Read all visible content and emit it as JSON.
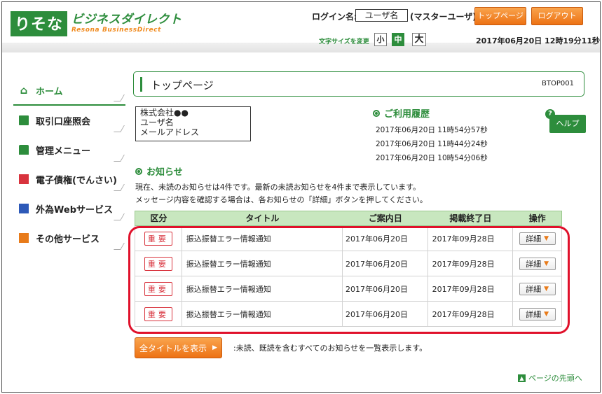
{
  "header": {
    "logo_mark": "りそな",
    "logo_jp": "ビジネスダイレクト",
    "logo_en": "Resona BusinessDirect",
    "login_label": "ログイン名:",
    "login_user": "ユーザ名",
    "login_role": "(マスターユーザ)",
    "top_page_label": "トップページへ",
    "logout_label": "ログアウト",
    "font_size_label": "文字サイズを変更",
    "font_small": "小",
    "font_mid": "中",
    "font_large": "大",
    "datetime": "2017年06月20日 12時19分11秒"
  },
  "sidebar": {
    "items": [
      {
        "label": "ホーム"
      },
      {
        "label": "取引口座照会"
      },
      {
        "label": "管理メニュー"
      },
      {
        "label": "電子債権(でんさい)"
      },
      {
        "label": "外為Webサービス"
      },
      {
        "label": "その他サービス"
      }
    ]
  },
  "main": {
    "page_title": "トップページ",
    "page_code": "BTOP001",
    "company": {
      "name": "株式会社●●",
      "user": "ユーザ名",
      "email": "メールアドレス"
    },
    "history": {
      "title": "ご利用履歴",
      "entries": [
        "2017年06月20日 11時54分57秒",
        "2017年06月20日 11時44分24秒",
        "2017年06月20日 10時54分06秒"
      ]
    },
    "help_label": "ヘルプ",
    "notice": {
      "title": "お知らせ",
      "text1": "現在、未読のお知らせは4件です。最新の未読お知らせを4件まで表示しています。",
      "text2": "メッセージ内容を確認する場合は、各お知らせの「詳細」ボタンを押してください。"
    },
    "table": {
      "headers": [
        "区分",
        "タイトル",
        "ご案内日",
        "掲載終了日",
        "操作"
      ],
      "rows": [
        {
          "category": "重要",
          "title": "振込振替エラー情報通知",
          "date": "2017年06月20日",
          "end_date": "2017年09月28日",
          "action": "詳細"
        },
        {
          "category": "重要",
          "title": "振込振替エラー情報通知",
          "date": "2017年06月20日",
          "end_date": "2017年09月28日",
          "action": "詳細"
        },
        {
          "category": "重要",
          "title": "振込振替エラー情報通知",
          "date": "2017年06月20日",
          "end_date": "2017年09月28日",
          "action": "詳細"
        },
        {
          "category": "重要",
          "title": "振込振替エラー情報通知",
          "date": "2017年06月20日",
          "end_date": "2017年09月28日",
          "action": "詳細"
        }
      ]
    },
    "all_titles_label": "全タイトルを表示",
    "all_titles_desc": ":未読、既読を含むすべてのお知らせを一覧表示します。",
    "page_top_label": "ページの先頭へ"
  },
  "colors": {
    "brand_green": "#2d8d3c",
    "accent_orange": "#ed7214",
    "alert_red": "#e0112b"
  }
}
